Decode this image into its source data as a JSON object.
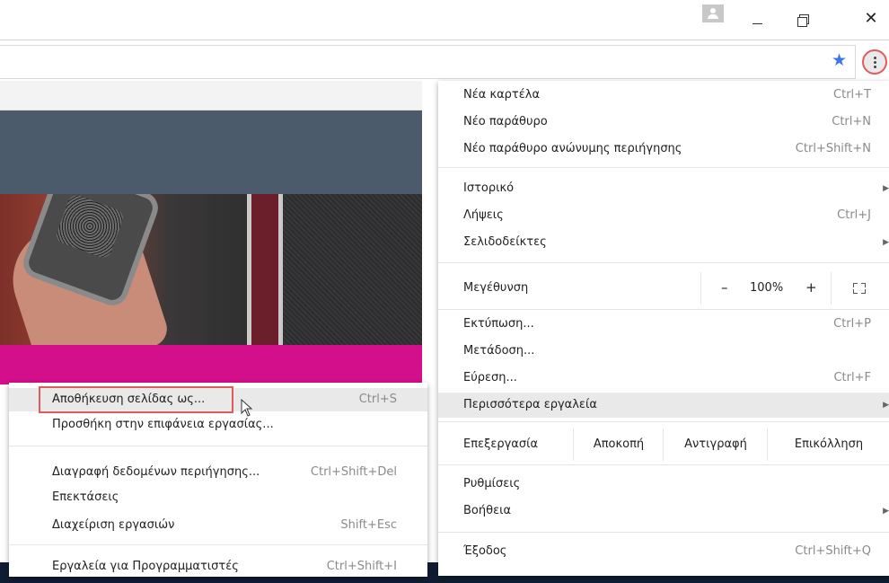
{
  "window": {
    "profile_icon": "person-icon",
    "minimize_icon": "minimize-icon",
    "restore_icon": "restore-icon",
    "close_glyph": "✕"
  },
  "toolbar": {
    "bookmark_icon": "star-icon",
    "bookmark_glyph": "★",
    "menu_icon": "three-dots-icon",
    "accent_color": "#3b78e7",
    "highlight_color": "#e05b5b"
  },
  "menu": {
    "new_tab": {
      "label": "Νέα καρτέλα",
      "shortcut": "Ctrl+T"
    },
    "new_window": {
      "label": "Νέο παράθυρο",
      "shortcut": "Ctrl+N"
    },
    "incognito": {
      "label": "Νέο παράθυρο ανώνυμης περιήγησης",
      "shortcut": "Ctrl+Shift+N"
    },
    "history": {
      "label": "Ιστορικό"
    },
    "downloads": {
      "label": "Λήψεις",
      "shortcut": "Ctrl+J"
    },
    "bookmarks": {
      "label": "Σελιδοδείκτες"
    },
    "zoom": {
      "label": "Μεγέθυνση",
      "minus": "–",
      "value": "100%",
      "plus": "+"
    },
    "print": {
      "label": "Εκτύπωση...",
      "shortcut": "Ctrl+P"
    },
    "cast": {
      "label": "Μετάδοση..."
    },
    "find": {
      "label": "Εύρεση...",
      "shortcut": "Ctrl+F"
    },
    "more_tools": {
      "label": "Περισσότερα εργαλεία"
    },
    "edit": {
      "label": "Επεξεργασία",
      "cut": "Αποκοπή",
      "copy": "Αντιγραφή",
      "paste": "Επικόλληση"
    },
    "settings": {
      "label": "Ρυθμίσεις"
    },
    "help": {
      "label": "Βοήθεια"
    },
    "exit": {
      "label": "Έξοδος",
      "shortcut": "Ctrl+Shift+Q"
    }
  },
  "submenu": {
    "save_page": {
      "label": "Αποθήκευση σελίδας ως...",
      "shortcut": "Ctrl+S"
    },
    "add_to_desktop": {
      "label": "Προσθήκη στην επιφάνεια εργασίας..."
    },
    "clear_data": {
      "label": "Διαγραφή δεδομένων περιήγησης...",
      "shortcut": "Ctrl+Shift+Del"
    },
    "extensions": {
      "label": "Επεκτάσεις"
    },
    "task_manager": {
      "label": "Διαχείριση εργασιών",
      "shortcut": "Shift+Esc"
    },
    "dev_tools": {
      "label": "Εργαλεία για Προγραμματιστές",
      "shortcut": "Ctrl+Shift+I"
    }
  },
  "page": {
    "band_color_slate": "#4c5b6b",
    "band_color_magenta": "#d40f8c",
    "band_color_navy": "#0f1d33"
  }
}
